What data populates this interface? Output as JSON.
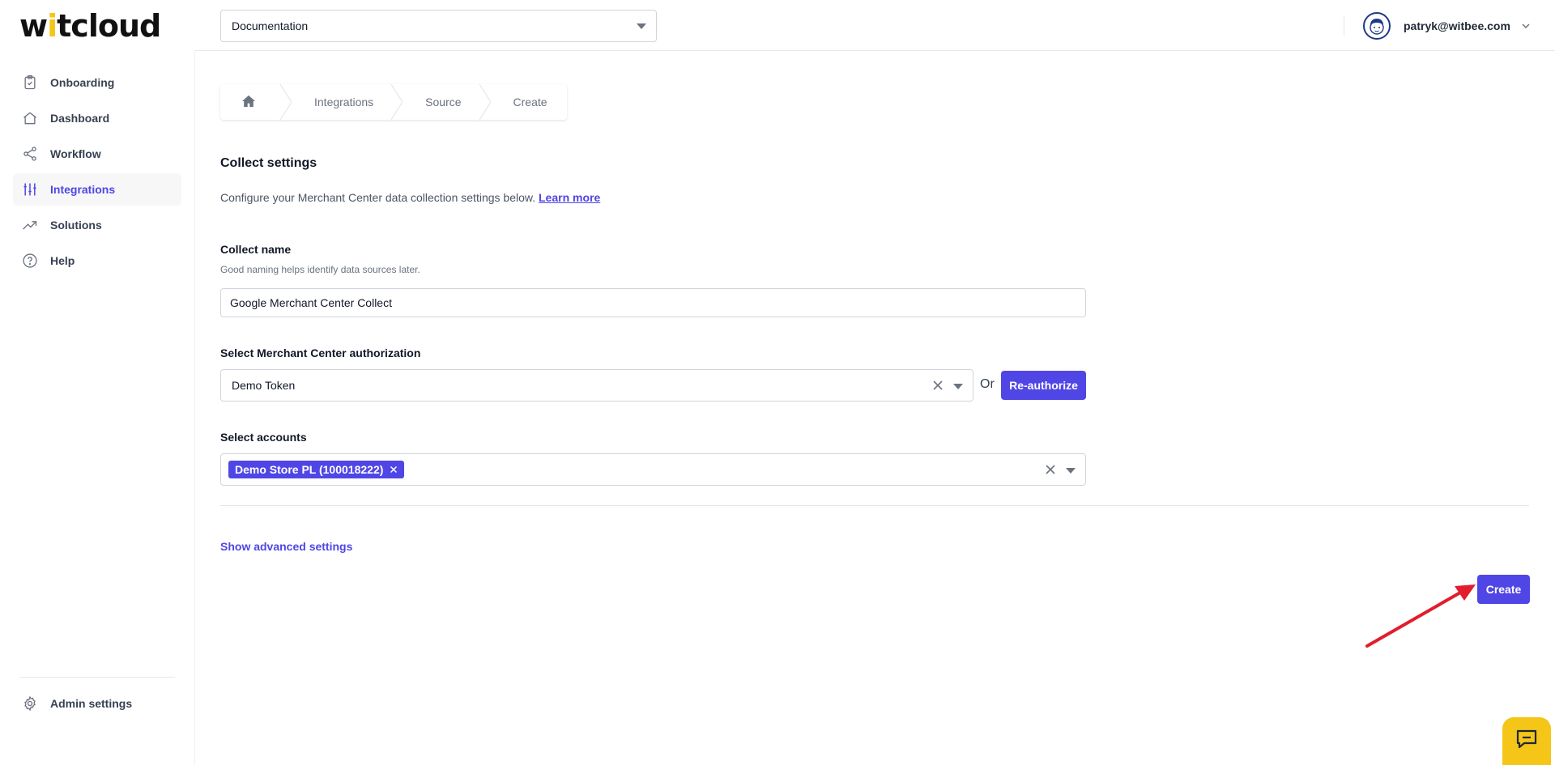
{
  "brand": {
    "logo_pre": "w",
    "logo_accent": "i",
    "logo_post": "tcloud",
    "accent_color": "#f5c518",
    "primary_color": "#4f46e5"
  },
  "sidebar": {
    "items": [
      {
        "label": "Onboarding",
        "icon": "clipboard-icon"
      },
      {
        "label": "Dashboard",
        "icon": "home-icon"
      },
      {
        "label": "Workflow",
        "icon": "share-icon"
      },
      {
        "label": "Integrations",
        "icon": "sliders-icon",
        "active": true
      },
      {
        "label": "Solutions",
        "icon": "trending-up-icon"
      },
      {
        "label": "Help",
        "icon": "help-circle-icon"
      }
    ],
    "admin_label": "Admin settings"
  },
  "header": {
    "workspace": "Documentation",
    "user_email": "patryk@witbee.com"
  },
  "breadcrumb": {
    "items": [
      "Integrations",
      "Source",
      "Create"
    ]
  },
  "form": {
    "section_title": "Collect settings",
    "intro_text": "Configure your Merchant Center data collection settings below.",
    "learn_more": "Learn more",
    "collect_name": {
      "label": "Collect name",
      "help": "Good naming helps identify data sources later.",
      "value": "Google Merchant Center Collect"
    },
    "authorization": {
      "label": "Select Merchant Center authorization",
      "value": "Demo Token",
      "or_text": "Or",
      "reauthorize_label": "Re-authorize"
    },
    "accounts": {
      "label": "Select accounts",
      "selected": [
        "Demo Store PL (100018222)"
      ]
    },
    "advanced_link": "Show advanced settings",
    "create_label": "Create"
  }
}
